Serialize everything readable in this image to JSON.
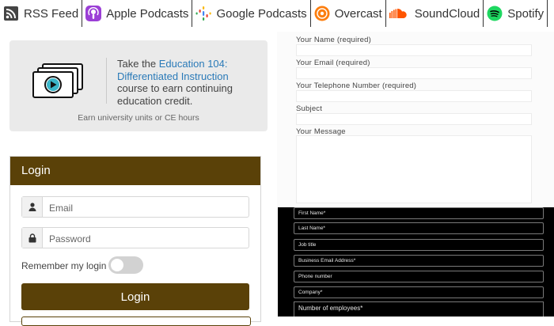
{
  "podcasts": [
    {
      "name": "RSS Feed",
      "icon": "rss-icon"
    },
    {
      "name": "Apple Podcasts",
      "icon": "apple-podcasts-icon"
    },
    {
      "name": "Google Podcasts",
      "icon": "google-podcasts-icon"
    },
    {
      "name": "Overcast",
      "icon": "overcast-icon"
    },
    {
      "name": "SoundCloud",
      "icon": "soundcloud-icon"
    },
    {
      "name": "Spotify",
      "icon": "spotify-icon"
    }
  ],
  "course": {
    "prefix": "Take the ",
    "link": "Education 104: Differentiated Instruction",
    "suffix": " course to earn continuing education credit.",
    "subtext": "Earn university units or CE hours",
    "icon": "video-play-icon"
  },
  "login": {
    "title": "Login",
    "email_placeholder": "Email",
    "password_placeholder": "Password",
    "remember_label": "Remember my login",
    "remember_checked": false,
    "button": "Login"
  },
  "contact_form": {
    "fields": [
      "Your Name (required)",
      "Your Email (required)",
      "Your Telephone Number (required)",
      "Subject"
    ],
    "message_label": "Your Message"
  },
  "lead_form": {
    "fields": [
      "First Name*",
      "Last Name*",
      "Job title",
      "Business Email Address*",
      "Phone number",
      "Company*"
    ],
    "last_field": "Number of employees*"
  },
  "colors": {
    "brand_brown": "#5a4108",
    "link_blue": "#2a7ab8",
    "card_bg": "#eaeaea"
  }
}
